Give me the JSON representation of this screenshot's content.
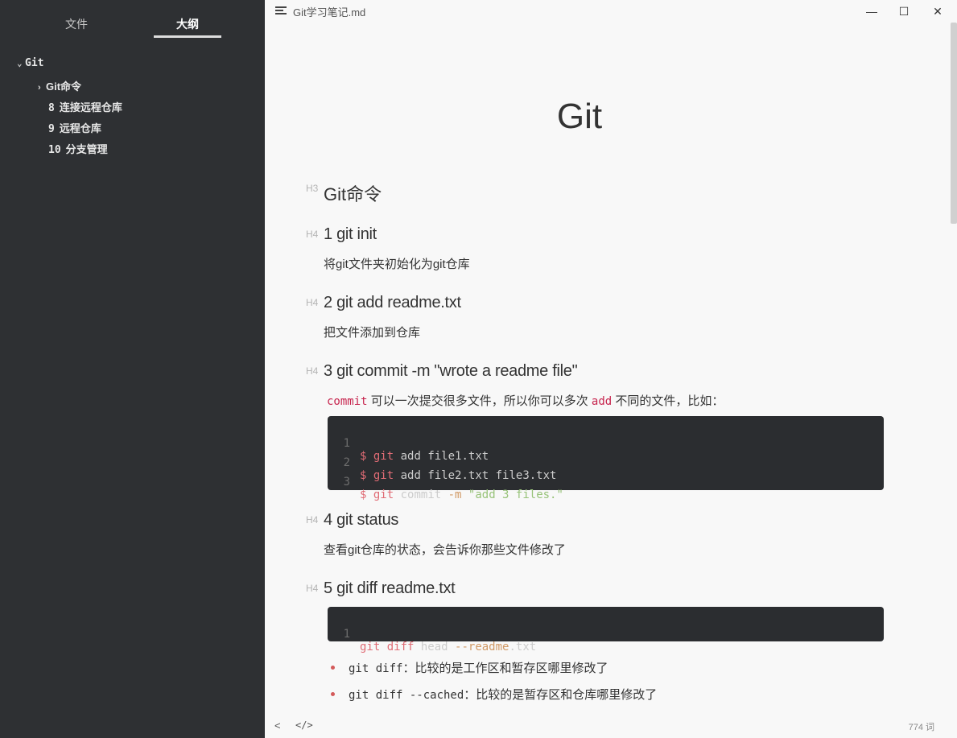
{
  "window": {
    "doc_title": "Git学习笔记.md",
    "controls": {
      "minimize": "—",
      "maximize": "☐",
      "close": "✕"
    }
  },
  "sidebar": {
    "tabs": [
      "文件",
      "大纲"
    ],
    "active_tab": "大纲",
    "outline": [
      {
        "caret": "⌄",
        "label": "Git"
      },
      {
        "caret": "›",
        "label": "Git命令"
      },
      {
        "num": "8",
        "label": "连接远程仓库"
      },
      {
        "num": "9",
        "label": "远程仓库"
      },
      {
        "num": "10",
        "label": "分支管理"
      }
    ]
  },
  "doc": {
    "h1": "Git",
    "h3_label": "H3",
    "h3": "Git命令",
    "h4_label": "H4",
    "sections": [
      {
        "title": "1 git init",
        "text": "将git文件夹初始化为git仓库"
      },
      {
        "title": "2 git add readme.txt",
        "text": "把文件添加到仓库"
      },
      {
        "title": "3 git commit -m \"wrote a readme file\""
      },
      {
        "title": "4 git status",
        "text": "查看git仓库的状态，会告诉你那些文件修改了"
      },
      {
        "title": "5 git diff readme.txt"
      }
    ],
    "commit_para": {
      "code1": "commit",
      "text1": " 可以一次提交很多文件，所以你可以多次 ",
      "code2": "add",
      "text2": " 不同的文件，比如："
    },
    "code_block_1": [
      {
        "n": "1",
        "dollar": "$",
        "git": "git",
        "rest": " add file1.txt"
      },
      {
        "n": "2",
        "dollar": "$",
        "git": "git",
        "rest": " add file2.txt file3.txt"
      },
      {
        "n": "3",
        "dollar": "$",
        "git": "git",
        "rest": " commit ",
        "flag": "-m",
        "str": "\"add 3 files.\""
      }
    ],
    "code_block_2": [
      {
        "n": "1",
        "git": "git",
        "diff": " diff",
        "head": " head ",
        "flag": "--readme",
        "ext": ".txt"
      }
    ],
    "bullets": [
      {
        "code": "git diff",
        "text": "：比较的是工作区和暂存区哪里修改了"
      },
      {
        "code": "git diff --cached",
        "text": "：比较的是暂存区和仓库哪里修改了"
      }
    ]
  },
  "status": {
    "left_icon": "<",
    "code_icon": "</>",
    "word_count": "774 词"
  }
}
